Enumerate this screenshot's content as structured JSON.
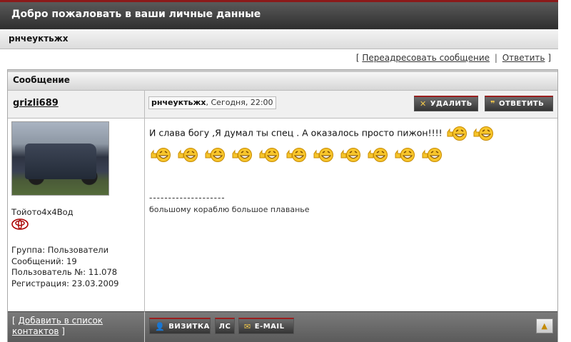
{
  "page": {
    "title": "Добро пожаловать в ваши личные данные",
    "subject": "рнчеуктьжх"
  },
  "links": {
    "open_bracket": "[",
    "forward": "Переадресовать сообщение",
    "separator": "|",
    "reply": "Ответить",
    "close_bracket": "]"
  },
  "post": {
    "section_title": "Сообщение",
    "author": {
      "username": "grizli689",
      "rank_text": "Тойото4х4Вод",
      "group": "Группа: Пользователи",
      "posts": "Сообщений: 19",
      "user_number": "Пользователь №: 11.078",
      "registered": "Регистрация: 23.03.2009"
    },
    "header": {
      "title": "рнчеуктьжх",
      "date": ", Сегодня, 22:00",
      "delete_label": "УДАЛИТЬ",
      "reply_label": "ОТВЕТИТЬ"
    },
    "body": {
      "text": "И слава богу ,Я думал ты спец . А оказалось просто пижон!!!!",
      "signature_divider": "--------------------",
      "signature": "большому кораблю большое плаванье"
    },
    "footer": {
      "add_contact_open": "[",
      "add_contact": "Добавить в список контактов",
      "add_contact_close": "]",
      "card_label": "ВИЗИТКА",
      "pm_label": "ЛС",
      "email_label": "E-MAIL"
    }
  },
  "icons": {
    "delete": "x-icon",
    "reply": "quote-icon",
    "card": "user-icon",
    "email": "envelope-icon",
    "top": "arrow-up-icon",
    "smiley": "laughing-thumbs-up-smiley-icon",
    "rank": "toyota-logo-icon"
  },
  "colors": {
    "accent_red": "#9b1e1e",
    "header_dark": "#343434",
    "smiley_yellow": "#f7c52b"
  }
}
